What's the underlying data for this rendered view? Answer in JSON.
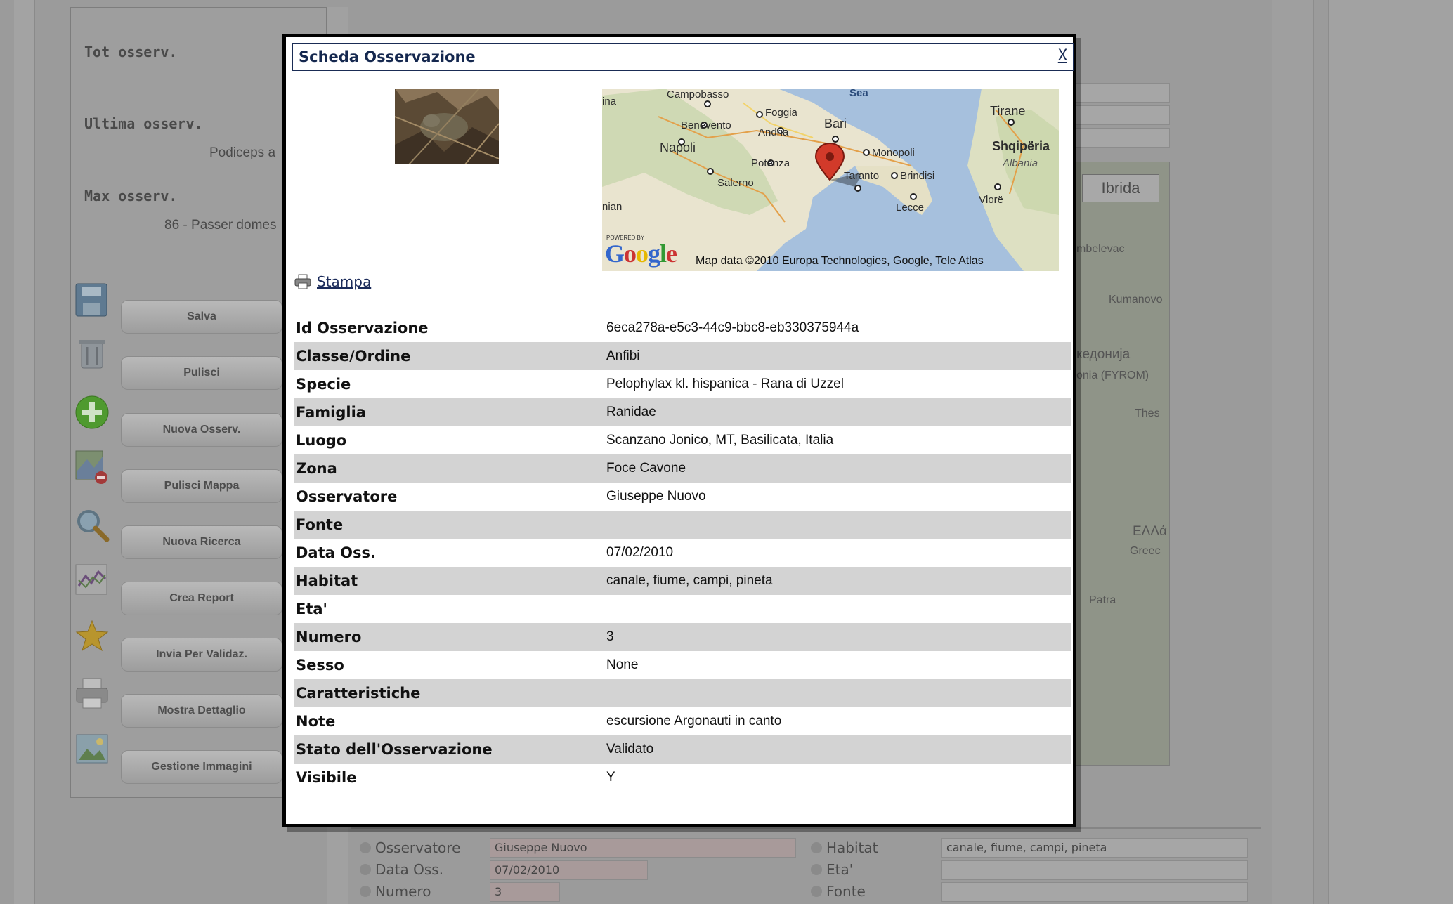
{
  "background": {
    "stats": {
      "tot_label": "Tot osserv.",
      "last_label": "Ultima osserv.",
      "last_value": "Podiceps a",
      "max_label": "Max osserv.",
      "max_value": "86 - Passer domes"
    },
    "side_buttons": [
      "Salva",
      "Pulisci",
      "Nuova Osserv.",
      "Pulisci Mappa",
      "Nuova Ricerca",
      "Crea Report",
      "Invia Per Validaz.",
      "Mostra Dettaglio",
      "Gestione Immagini"
    ],
    "map_type_button": "Ibrida",
    "map_labels": [
      "mbelevac",
      "Kumanovo",
      "кедонија",
      "onia (FYROM)",
      "Thes",
      "ΕΛΛά",
      "Greec",
      "Patra"
    ],
    "form": {
      "observer_label": "Osservatore",
      "observer_value": "Giuseppe Nuovo",
      "date_label": "Data Oss.",
      "date_value": "07/02/2010",
      "number_label": "Numero",
      "number_value": "3",
      "habitat_label": "Habitat",
      "habitat_value": "canale, fiume, campi, pineta",
      "age_label": "Eta'",
      "age_value": "",
      "source_label": "Fonte",
      "source_value": ""
    }
  },
  "modal": {
    "title": "Scheda Osservazione",
    "close_label": "X",
    "print_label": "Stampa",
    "map": {
      "cities": [
        "Campobasso",
        "Foggia",
        "Benevento",
        "Andria",
        "Bari",
        "Napoli",
        "Monopoli",
        "Potenza",
        "Taranto",
        "Brindisi",
        "Salerno",
        "Lecce",
        "Tirane",
        "Shqipëria",
        "Albania",
        "Vlorë",
        "Sea",
        "ina",
        "nian"
      ],
      "google_logo": "Google",
      "powered_by": "POWERED BY",
      "copyright": "Map data ©2010 Europa Technologies, Google, Tele Atlas"
    },
    "rows": [
      {
        "key": "Id Osservazione",
        "value": "6eca278a-e5c3-44c9-bbc8-eb330375944a"
      },
      {
        "key": "Classe/Ordine",
        "value": "Anfibi"
      },
      {
        "key": "Specie",
        "value": "Pelophylax kl. hispanica - Rana di Uzzel"
      },
      {
        "key": "Famiglia",
        "value": "Ranidae"
      },
      {
        "key": "Luogo",
        "value": "Scanzano Jonico, MT, Basilicata, Italia"
      },
      {
        "key": "Zona",
        "value": "Foce Cavone"
      },
      {
        "key": "Osservatore",
        "value": "Giuseppe Nuovo"
      },
      {
        "key": "Fonte",
        "value": ""
      },
      {
        "key": "Data Oss.",
        "value": "07/02/2010"
      },
      {
        "key": "Habitat",
        "value": "canale, fiume, campi, pineta"
      },
      {
        "key": "Eta'",
        "value": ""
      },
      {
        "key": "Numero",
        "value": "3"
      },
      {
        "key": "Sesso",
        "value": "None"
      },
      {
        "key": "Caratteristiche",
        "value": ""
      },
      {
        "key": "Note",
        "value": "escursione Argonauti in canto"
      },
      {
        "key": "Stato dell'Osservazione",
        "value": "Validato"
      },
      {
        "key": "Visibile",
        "value": "Y"
      }
    ]
  }
}
